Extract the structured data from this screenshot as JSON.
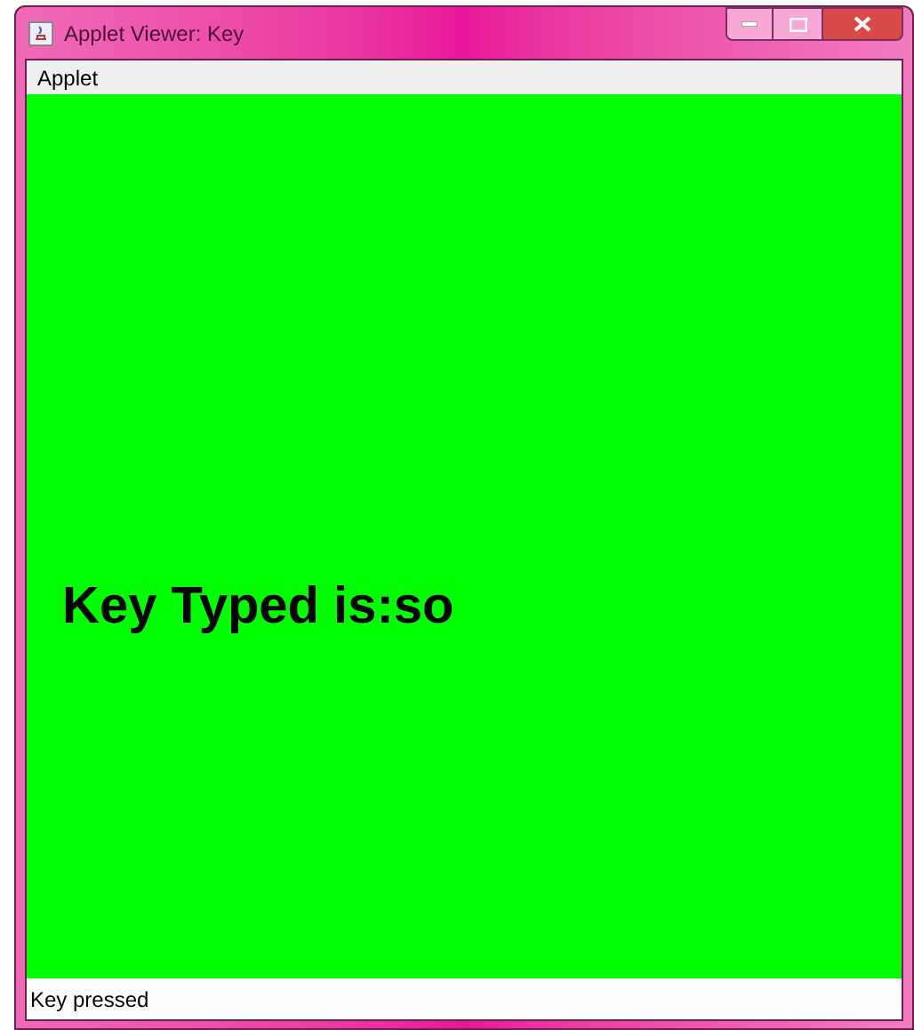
{
  "window": {
    "title": "Applet Viewer: Key"
  },
  "menu": [
    "Applet"
  ],
  "applet": {
    "message": "Key Typed is:so"
  },
  "status_bar": "Key pressed"
}
